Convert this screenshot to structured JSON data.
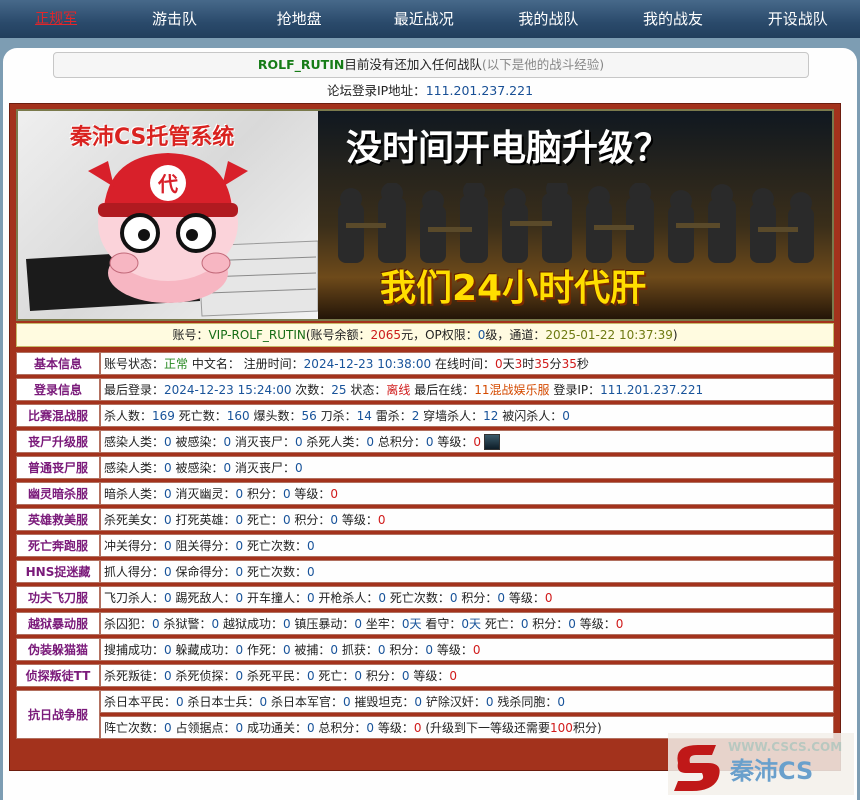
{
  "nav": {
    "items": [
      "正规军",
      "游击队",
      "抢地盘",
      "最近战况",
      "我的战队",
      "我的战友",
      "开设战队"
    ]
  },
  "message": {
    "name": "ROLF_RUTIN",
    "text": "目前没有还加入任何战队",
    "note": "(以下是他的战斗经验)"
  },
  "ip_line": {
    "label": "论坛登录IP地址：",
    "ip": "111.201.237.221"
  },
  "banner": {
    "logo": "秦沛CS托管系统",
    "badge": "代",
    "headline": "没时间开电脑升级？",
    "subline": "我们24小时代肝"
  },
  "account": {
    "label": "账号：",
    "id": "VIP-ROLF_RUTIN",
    "balance_label": "(账号余额：",
    "balance": "2065",
    "op_label": "元，OP权限：",
    "op": "0",
    "channel_label": "级，通道：",
    "time": "2025-01-22 10:37:39",
    "end": ")"
  },
  "rows": [
    {
      "label": "基本信息",
      "parts": [
        {
          "t": "账号状态："
        },
        {
          "t": "正常",
          "c": "v-green"
        },
        {
          "t": " 中文名：  注册时间："
        },
        {
          "t": "2024-12-23 10:38:00",
          "c": "v-blue"
        },
        {
          "t": " 在线时间："
        },
        {
          "t": "0",
          "c": "v-red"
        },
        {
          "t": "天"
        },
        {
          "t": "3",
          "c": "v-red"
        },
        {
          "t": "时"
        },
        {
          "t": "35",
          "c": "v-red"
        },
        {
          "t": "分"
        },
        {
          "t": "35",
          "c": "v-red"
        },
        {
          "t": "秒"
        }
      ]
    },
    {
      "label": "登录信息",
      "parts": [
        {
          "t": "最后登录："
        },
        {
          "t": "2024-12-23 15:24:00",
          "c": "v-blue"
        },
        {
          "t": " 次数："
        },
        {
          "t": "25",
          "c": "v-blue"
        },
        {
          "t": " 状态："
        },
        {
          "t": "离线",
          "c": "v-red"
        },
        {
          "t": " 最后在线："
        },
        {
          "t": "11混战娱乐服",
          "c": "v-orange"
        },
        {
          "t": " 登录IP："
        },
        {
          "t": "111.201.237.221",
          "c": "v-blue"
        }
      ]
    },
    {
      "label": "比赛混战服",
      "parts": [
        {
          "t": "杀人数："
        },
        {
          "t": "169",
          "c": "v-blue"
        },
        {
          "t": " 死亡数："
        },
        {
          "t": "160",
          "c": "v-blue"
        },
        {
          "t": " 爆头数："
        },
        {
          "t": "56",
          "c": "v-blue"
        },
        {
          "t": " 刀杀："
        },
        {
          "t": "14",
          "c": "v-blue"
        },
        {
          "t": " 雷杀："
        },
        {
          "t": "2",
          "c": "v-blue"
        },
        {
          "t": " 穿墙杀人："
        },
        {
          "t": "12",
          "c": "v-blue"
        },
        {
          "t": " 被闪杀人："
        },
        {
          "t": "0",
          "c": "v-blue"
        }
      ]
    },
    {
      "label": "丧尸升级服",
      "parts": [
        {
          "t": "感染人类："
        },
        {
          "t": "0",
          "c": "v-blue"
        },
        {
          "t": " 被感染："
        },
        {
          "t": "0",
          "c": "v-blue"
        },
        {
          "t": " 消灭丧尸："
        },
        {
          "t": "0",
          "c": "v-blue"
        },
        {
          "t": " 杀死人类："
        },
        {
          "t": "0",
          "c": "v-blue"
        },
        {
          "t": " 总积分："
        },
        {
          "t": "0",
          "c": "v-blue"
        },
        {
          "t": " 等级："
        },
        {
          "t": "0",
          "c": "v-red"
        }
      ],
      "avatar": true
    },
    {
      "label": "普通丧尸服",
      "parts": [
        {
          "t": "感染人类："
        },
        {
          "t": "0",
          "c": "v-blue"
        },
        {
          "t": " 被感染："
        },
        {
          "t": "0",
          "c": "v-blue"
        },
        {
          "t": " 消灭丧尸："
        },
        {
          "t": "0",
          "c": "v-blue"
        }
      ]
    },
    {
      "label": "幽灵暗杀服",
      "parts": [
        {
          "t": "暗杀人类："
        },
        {
          "t": "0",
          "c": "v-blue"
        },
        {
          "t": " 消灭幽灵："
        },
        {
          "t": "0",
          "c": "v-blue"
        },
        {
          "t": " 积分："
        },
        {
          "t": "0",
          "c": "v-blue"
        },
        {
          "t": " 等级："
        },
        {
          "t": "0",
          "c": "v-red"
        }
      ]
    },
    {
      "label": "英雄救美服",
      "parts": [
        {
          "t": "杀死美女："
        },
        {
          "t": "0",
          "c": "v-blue"
        },
        {
          "t": " 打死英雄："
        },
        {
          "t": "0",
          "c": "v-blue"
        },
        {
          "t": " 死亡："
        },
        {
          "t": "0",
          "c": "v-blue"
        },
        {
          "t": " 积分："
        },
        {
          "t": "0",
          "c": "v-blue"
        },
        {
          "t": " 等级："
        },
        {
          "t": "0",
          "c": "v-red"
        }
      ]
    },
    {
      "label": "死亡奔跑服",
      "parts": [
        {
          "t": "冲关得分："
        },
        {
          "t": "0",
          "c": "v-blue"
        },
        {
          "t": " 阻关得分："
        },
        {
          "t": "0",
          "c": "v-blue"
        },
        {
          "t": " 死亡次数："
        },
        {
          "t": "0",
          "c": "v-blue"
        }
      ]
    },
    {
      "label": "HNS捉迷藏",
      "parts": [
        {
          "t": "抓人得分："
        },
        {
          "t": "0",
          "c": "v-blue"
        },
        {
          "t": " 保命得分："
        },
        {
          "t": "0",
          "c": "v-blue"
        },
        {
          "t": " 死亡次数："
        },
        {
          "t": "0",
          "c": "v-blue"
        }
      ]
    },
    {
      "label": "功夫飞刀服",
      "parts": [
        {
          "t": "飞刀杀人："
        },
        {
          "t": "0",
          "c": "v-blue"
        },
        {
          "t": " 踢死敌人："
        },
        {
          "t": "0",
          "c": "v-blue"
        },
        {
          "t": " 开车撞人："
        },
        {
          "t": "0",
          "c": "v-blue"
        },
        {
          "t": " 开枪杀人："
        },
        {
          "t": "0",
          "c": "v-blue"
        },
        {
          "t": " 死亡次数："
        },
        {
          "t": "0",
          "c": "v-blue"
        },
        {
          "t": " 积分："
        },
        {
          "t": "0",
          "c": "v-blue"
        },
        {
          "t": " 等级："
        },
        {
          "t": "0",
          "c": "v-red"
        }
      ]
    },
    {
      "label": "越狱暴动服",
      "parts": [
        {
          "t": "杀囚犯："
        },
        {
          "t": "0",
          "c": "v-blue"
        },
        {
          "t": " 杀狱警："
        },
        {
          "t": "0",
          "c": "v-blue"
        },
        {
          "t": " 越狱成功："
        },
        {
          "t": "0",
          "c": "v-blue"
        },
        {
          "t": " 镇压暴动："
        },
        {
          "t": "0",
          "c": "v-blue"
        },
        {
          "t": " 坐牢："
        },
        {
          "t": "0天",
          "c": "v-blue"
        },
        {
          "t": " 看守："
        },
        {
          "t": "0天",
          "c": "v-blue"
        },
        {
          "t": " 死亡："
        },
        {
          "t": "0",
          "c": "v-blue"
        },
        {
          "t": " 积分："
        },
        {
          "t": "0",
          "c": "v-blue"
        },
        {
          "t": " 等级："
        },
        {
          "t": "0",
          "c": "v-red"
        }
      ]
    },
    {
      "label": "伪装躲猫猫",
      "parts": [
        {
          "t": "搜捕成功："
        },
        {
          "t": "0",
          "c": "v-blue"
        },
        {
          "t": " 躲藏成功："
        },
        {
          "t": "0",
          "c": "v-blue"
        },
        {
          "t": " 作死："
        },
        {
          "t": "0",
          "c": "v-blue"
        },
        {
          "t": " 被捕："
        },
        {
          "t": "0",
          "c": "v-blue"
        },
        {
          "t": " 抓获："
        },
        {
          "t": "0",
          "c": "v-blue"
        },
        {
          "t": " 积分："
        },
        {
          "t": "0",
          "c": "v-blue"
        },
        {
          "t": " 等级："
        },
        {
          "t": "0",
          "c": "v-red"
        }
      ]
    },
    {
      "label": "侦探叛徒TT",
      "parts": [
        {
          "t": "杀死叛徒："
        },
        {
          "t": "0",
          "c": "v-blue"
        },
        {
          "t": " 杀死侦探："
        },
        {
          "t": "0",
          "c": "v-blue"
        },
        {
          "t": " 杀死平民："
        },
        {
          "t": "0",
          "c": "v-blue"
        },
        {
          "t": " 死亡："
        },
        {
          "t": "0",
          "c": "v-blue"
        },
        {
          "t": " 积分："
        },
        {
          "t": "0",
          "c": "v-blue"
        },
        {
          "t": " 等级："
        },
        {
          "t": "0",
          "c": "v-red"
        }
      ]
    }
  ],
  "antiwar": {
    "label": "抗日战争服",
    "line1": [
      {
        "t": "杀日本平民："
      },
      {
        "t": "0",
        "c": "v-blue"
      },
      {
        "t": " 杀日本士兵："
      },
      {
        "t": "0",
        "c": "v-blue"
      },
      {
        "t": " 杀日本军官："
      },
      {
        "t": "0",
        "c": "v-blue"
      },
      {
        "t": " 摧毁坦克："
      },
      {
        "t": "0",
        "c": "v-blue"
      },
      {
        "t": " 铲除汉奸："
      },
      {
        "t": "0",
        "c": "v-blue"
      },
      {
        "t": " 残杀同胞："
      },
      {
        "t": "0",
        "c": "v-blue"
      }
    ],
    "line2": [
      {
        "t": "阵亡次数："
      },
      {
        "t": "0",
        "c": "v-blue"
      },
      {
        "t": " 占领据点："
      },
      {
        "t": "0",
        "c": "v-blue"
      },
      {
        "t": " 成功通关："
      },
      {
        "t": "0",
        "c": "v-blue"
      },
      {
        "t": " 总积分："
      },
      {
        "t": "0",
        "c": "v-blue"
      },
      {
        "t": " 等级："
      },
      {
        "t": "0",
        "c": "v-red"
      },
      {
        "t": " (升级到下一等级还需要"
      },
      {
        "t": "100",
        "c": "v-red"
      },
      {
        "t": "积分)"
      }
    ]
  },
  "watermark": "秦沛CS"
}
